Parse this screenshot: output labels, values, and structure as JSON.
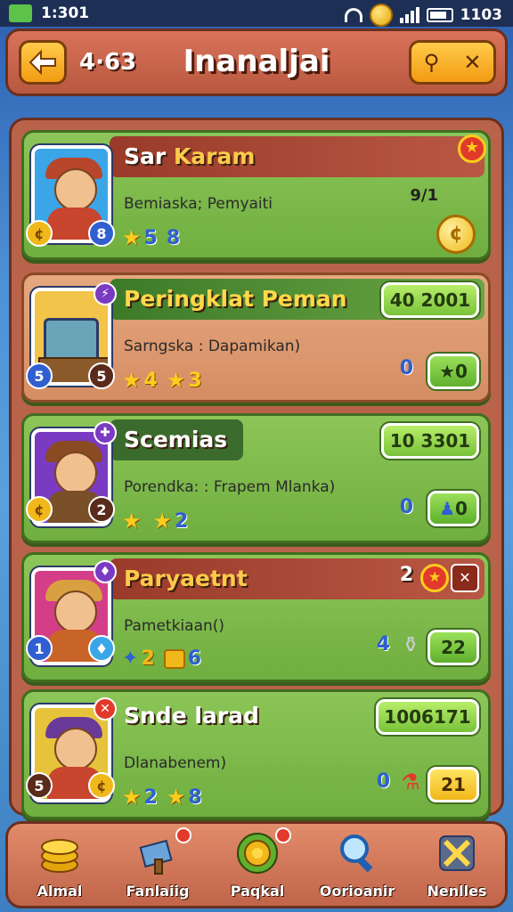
{
  "status_bar": {
    "time": "1:301",
    "clock_right": "1103"
  },
  "header": {
    "level": "4·63",
    "title": "Inanaljai",
    "right_button_symbols": [
      "⚲",
      "✕"
    ]
  },
  "cards": [
    {
      "name_part1": "Sar ",
      "name_part2": "Karam",
      "subtitle": "Bemiaska; Pemyaiti",
      "right_value": "9/1",
      "stats": [
        {
          "icon": "star",
          "value": "5"
        },
        {
          "icon": "number",
          "value": "8"
        }
      ],
      "badge_left": "¢",
      "badge_right": "8",
      "corner_badge": "★",
      "colors": {
        "portrait_bg": "#3aa6e8",
        "hat": "#b8462a",
        "body": "#c8452e"
      }
    },
    {
      "name_part1": "Peringklat Peman",
      "subtitle": "Sarngska : Dapamikan)",
      "score": "40 2001",
      "stats": [
        {
          "icon": "star",
          "value": "4"
        },
        {
          "icon": "star",
          "value": "3"
        }
      ],
      "right_num": "0",
      "action": "★0",
      "badge_left": "5",
      "badge_right": "5",
      "corner_badge": "⚡",
      "colors": {
        "portrait_bg": "#f2c44a"
      }
    },
    {
      "name_part1": "Scemias",
      "subtitle": "Porendka: : Frapem Mlanka)",
      "score": "10 3301",
      "stats": [
        {
          "icon": "star",
          "value": ""
        },
        {
          "icon": "star",
          "value": "2"
        }
      ],
      "right_num": "0",
      "action": "0",
      "badge_left": "¢",
      "badge_right": "2",
      "corner_badge": "✚",
      "colors": {
        "portrait_bg": "#7a3bc2",
        "hat": "#8a4a22",
        "body": "#7a5028"
      }
    },
    {
      "name_part1": "Paryaetnt",
      "subtitle": "Pametkiaan()",
      "top_num": "2",
      "stats": [
        {
          "icon": "gem",
          "value": "2"
        },
        {
          "icon": "box",
          "value": "6"
        }
      ],
      "right_num": "4",
      "action": "22",
      "badge_left": "1",
      "badge_right": "♦",
      "corner_badge": "♦",
      "colors": {
        "portrait_bg": "#d43e88",
        "hat": "#d8a040",
        "body": "#c86428"
      }
    },
    {
      "name_part1": "Snde larad",
      "subtitle": "Dlanabenem)",
      "score": "1006171",
      "stats": [
        {
          "icon": "star",
          "value": "2"
        },
        {
          "icon": "star",
          "value": "8"
        }
      ],
      "right_num": "0",
      "action": "21",
      "badge_left": "5",
      "badge_right": "¢",
      "corner_badge": "✕",
      "colors": {
        "portrait_bg": "#e6c33a",
        "hat": "#6a3a9a",
        "body": "#c8452e"
      }
    }
  ],
  "bottom_nav": [
    {
      "label": "Almal",
      "icon": "coin-stack-icon"
    },
    {
      "label": "Fanlaiig",
      "icon": "hammer-icon"
    },
    {
      "label": "Paqkal",
      "icon": "target-icon"
    },
    {
      "label": "Oorioanir",
      "icon": "search-icon"
    },
    {
      "label": "Nenlles",
      "icon": "crossed-swords-icon"
    }
  ]
}
